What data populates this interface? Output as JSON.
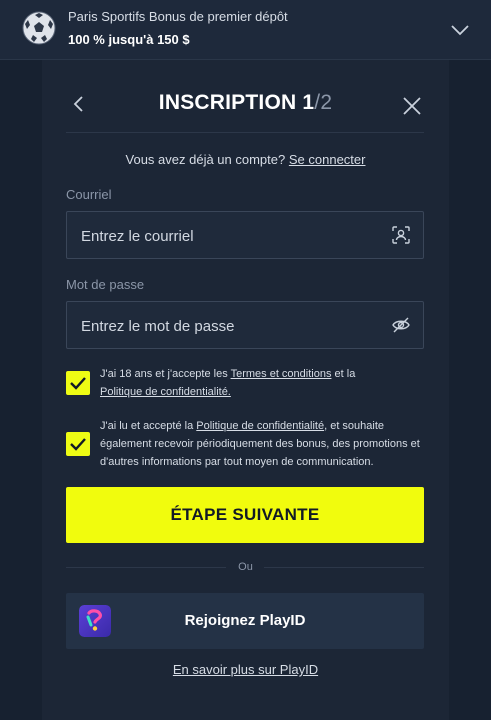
{
  "promo": {
    "title": "Paris Sportifs Bonus de premier dépôt",
    "amount": "100 % jusqu'à 150 $"
  },
  "header": {
    "title": "INSCRIPTION",
    "step_current": "1",
    "step_total": "/2"
  },
  "login": {
    "prompt": "Vous avez déjà un compte?",
    "link": "Se connecter"
  },
  "email": {
    "label": "Courriel",
    "placeholder": "Entrez le courriel",
    "value": ""
  },
  "password": {
    "label": "Mot de passe",
    "placeholder": "Entrez le mot de passe",
    "value": ""
  },
  "consent_terms": {
    "checked": true,
    "text_before": "J'ai 18 ans et j'accepte les ",
    "terms_link": "Termes et conditions",
    "text_middle": " et la",
    "privacy_link": "Politique de confidentialité."
  },
  "consent_marketing": {
    "checked": true,
    "text_before": "J'ai lu et accepté la ",
    "privacy_link": "Politique de confidentialité",
    "text_after": ", et souhaite également recevoir périodiquement des bonus, des promotions et d'autres informations par tout moyen de communication."
  },
  "next_button": "ÉTAPE SUIVANTE",
  "divider_text": "Ou",
  "playid": {
    "button_label": "Rejoignez PlayID",
    "learn_more": "En savoir plus sur PlayID"
  },
  "colors": {
    "accent": "#f1fc0d",
    "background": "#172130",
    "panel": "#1c2636"
  },
  "icons": {
    "promo": "soccer-ball-icon",
    "expand": "chevron-down-icon",
    "back": "chevron-left-icon",
    "close": "close-icon",
    "email_field": "face-scan-icon",
    "password_field": "eye-off-icon",
    "checkbox": "checkmark-icon",
    "playid": "playid-logo-icon"
  }
}
